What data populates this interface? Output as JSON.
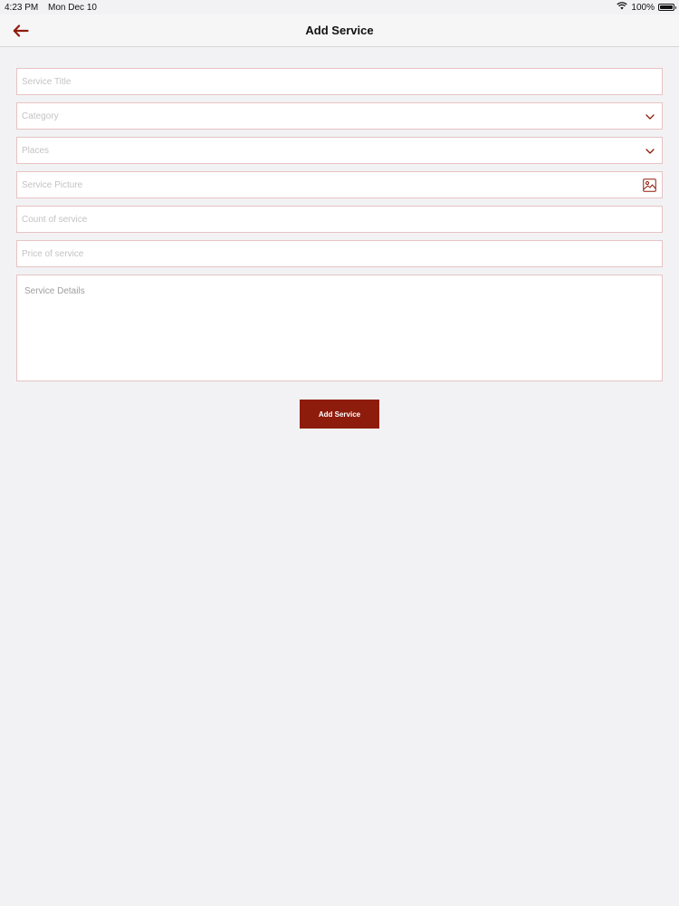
{
  "status_bar": {
    "time": "4:23 PM",
    "date": "Mon Dec 10",
    "battery": "100%",
    "battery_level": 1.0
  },
  "nav": {
    "title": "Add Service",
    "back_icon": "arrow-left-icon"
  },
  "form": {
    "service_title": {
      "placeholder": "Service Title",
      "value": ""
    },
    "category": {
      "placeholder": "Category",
      "value": "",
      "icon": "chevron-down-icon"
    },
    "places": {
      "placeholder": "Places",
      "value": "",
      "icon": "chevron-down-icon"
    },
    "service_picture": {
      "placeholder": "Service Picture",
      "value": "",
      "icon": "image-icon"
    },
    "count": {
      "placeholder": "Count of service",
      "value": ""
    },
    "price": {
      "placeholder": "Price of service",
      "value": ""
    },
    "details": {
      "placeholder": "Service Details",
      "value": ""
    },
    "submit_label": "Add Service"
  },
  "colors": {
    "accent": "#8e1c0c",
    "field_border": "#e7c3c3",
    "background": "#f2f2f4"
  }
}
